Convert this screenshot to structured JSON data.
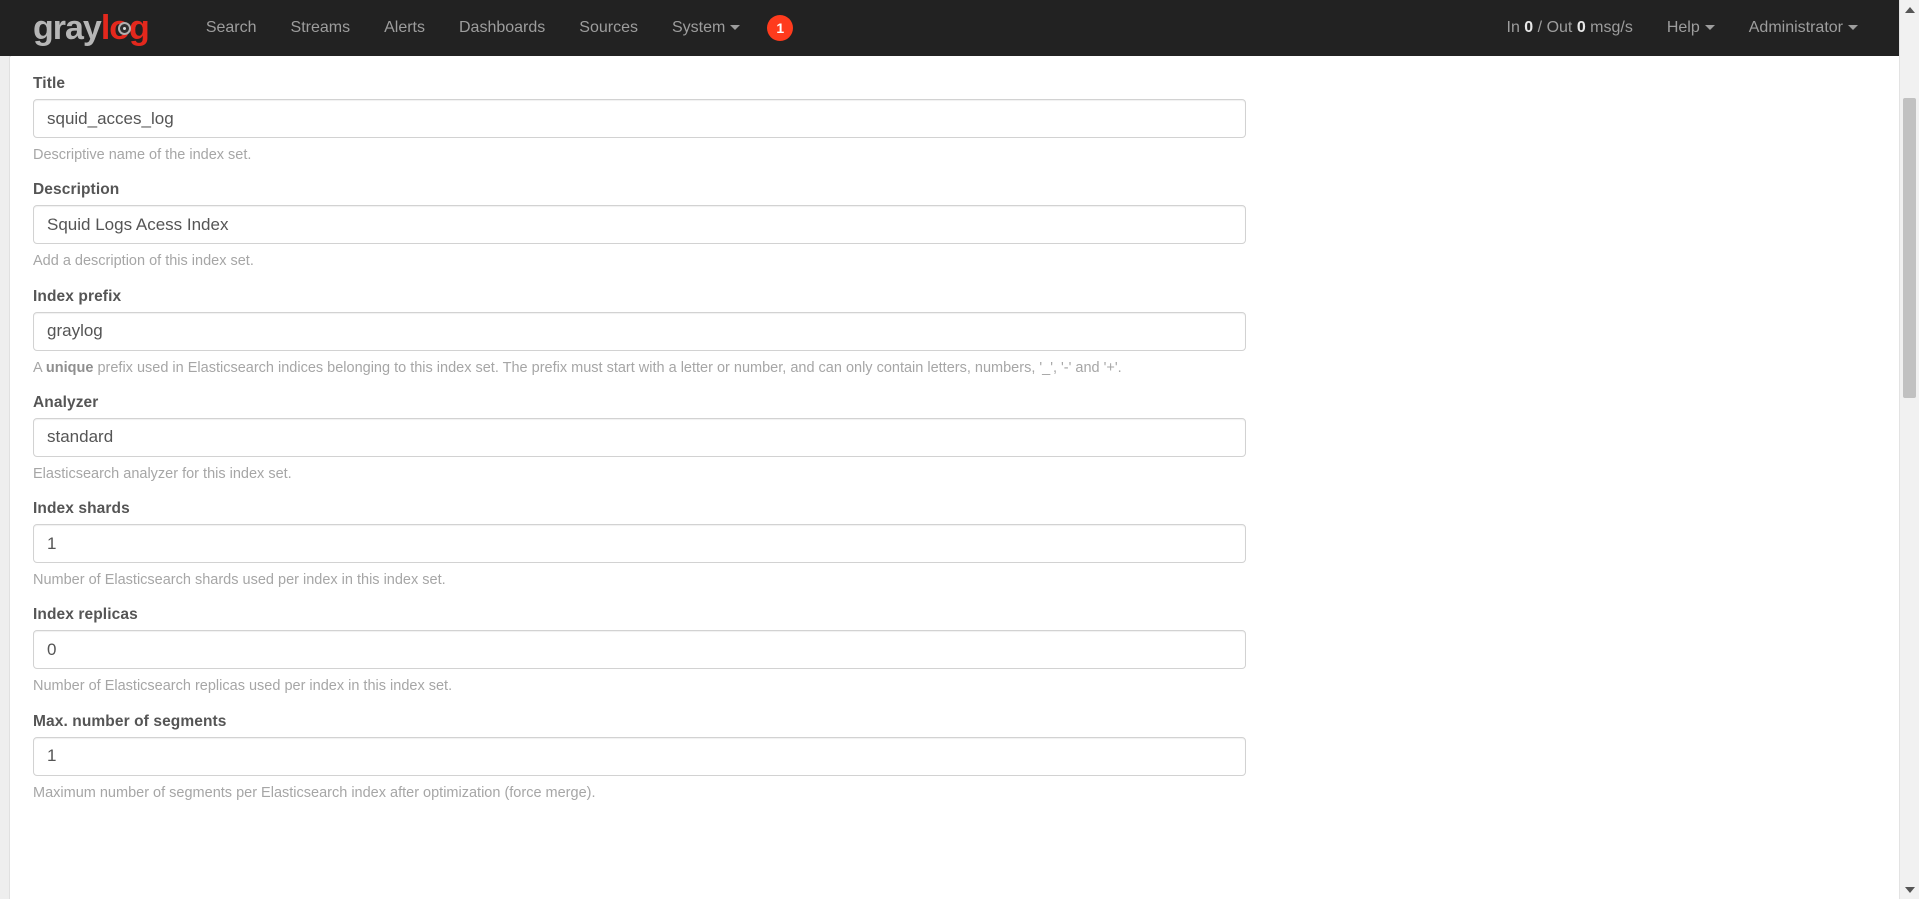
{
  "navbar": {
    "brand": {
      "part1": "gray",
      "part2": "log"
    },
    "items": [
      {
        "label": "Search",
        "name": "nav-item-search",
        "caret": false
      },
      {
        "label": "Streams",
        "name": "nav-item-streams",
        "caret": false
      },
      {
        "label": "Alerts",
        "name": "nav-item-alerts",
        "caret": false
      },
      {
        "label": "Dashboards",
        "name": "nav-item-dashboards",
        "caret": false
      },
      {
        "label": "Sources",
        "name": "nav-item-sources",
        "caret": false
      },
      {
        "label": "System",
        "name": "nav-item-system",
        "caret": true
      }
    ],
    "notification_badge": "1",
    "throughput": {
      "in_label": "In",
      "in_value": "0",
      "separator": "/",
      "out_label": "Out",
      "out_value": "0",
      "unit": "msg/s"
    },
    "help_label": "Help",
    "user_label": "Administrator",
    "background_color": "#222222",
    "badge_color": "#ff3b1d"
  },
  "form": {
    "fields": [
      {
        "label": "Title",
        "value": "squid_acces_log",
        "placeholder": "",
        "help": "Descriptive name of the index set.",
        "name": "title"
      },
      {
        "label": "Description",
        "value": "Squid Logs Acess Index",
        "placeholder": "",
        "help": "Add a description of this index set.",
        "name": "description"
      },
      {
        "label": "Index prefix",
        "value": "graylog",
        "placeholder": "",
        "help_pre": "A ",
        "help_bold": "unique",
        "help_post": " prefix used in Elasticsearch indices belonging to this index set. The prefix must start with a letter or number, and can only contain letters, numbers, '_', '-' and '+'.",
        "name": "index-prefix"
      },
      {
        "label": "Analyzer",
        "value": "standard",
        "placeholder": "",
        "help": "Elasticsearch analyzer for this index set.",
        "name": "analyzer"
      },
      {
        "label": "Index shards",
        "value": "1",
        "placeholder": "",
        "help": "Number of Elasticsearch shards used per index in this index set.",
        "name": "index-shards"
      },
      {
        "label": "Index replicas",
        "value": "0",
        "placeholder": "",
        "help": "Number of Elasticsearch replicas used per index in this index set.",
        "name": "index-replicas"
      },
      {
        "label": "Max. number of segments",
        "value": "1",
        "placeholder": "",
        "help": "Maximum number of segments per Elasticsearch index after optimization (force merge).",
        "name": "max-segments"
      }
    ]
  },
  "scrollbar": {
    "position_percent": 10
  }
}
